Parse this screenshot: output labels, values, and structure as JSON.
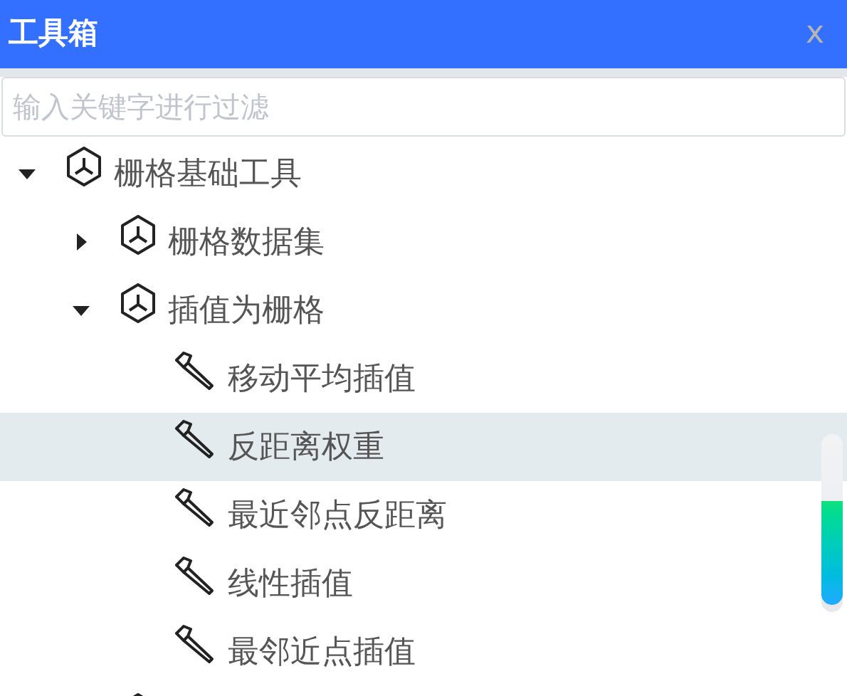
{
  "panel": {
    "title": "工具箱",
    "close": "x"
  },
  "search": {
    "placeholder": "输入关键字进行过滤"
  },
  "tree": [
    {
      "kind": "group",
      "label": "栅格基础工具",
      "expanded": true,
      "selected": false,
      "children": [
        {
          "kind": "group",
          "label": "栅格数据集",
          "expanded": false,
          "selected": false
        },
        {
          "kind": "group",
          "label": "插值为栅格",
          "expanded": true,
          "selected": false,
          "children": [
            {
              "kind": "tool",
              "label": "移动平均插值",
              "selected": false
            },
            {
              "kind": "tool",
              "label": "反距离权重",
              "selected": true
            },
            {
              "kind": "tool",
              "label": "最近邻点反距离",
              "selected": false
            },
            {
              "kind": "tool",
              "label": "线性插值",
              "selected": false
            },
            {
              "kind": "tool",
              "label": "最邻近点插值",
              "selected": false
            }
          ]
        },
        {
          "kind": "group",
          "selected": false
        }
      ]
    }
  ]
}
